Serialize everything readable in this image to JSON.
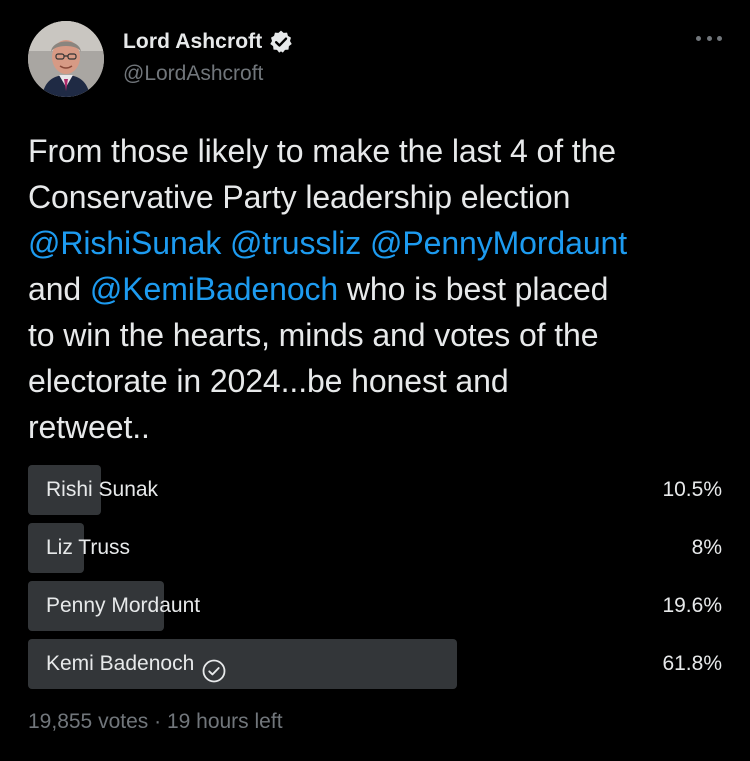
{
  "author": {
    "name": "Lord Ashcroft",
    "handle": "@LordAshcroft",
    "verified": true,
    "avatar_icon": "profile-photo"
  },
  "tweet": {
    "lines": [
      [
        {
          "text": "From those likely to make the last 4 of the",
          "mention": false
        }
      ],
      [
        {
          "text": "Conservative Party leadership election",
          "mention": false
        }
      ],
      [
        {
          "text": "@RishiSunak",
          "mention": true
        },
        {
          "text": " ",
          "mention": false
        },
        {
          "text": "@trussliz",
          "mention": true
        },
        {
          "text": " ",
          "mention": false
        },
        {
          "text": "@PennyMordaunt",
          "mention": true
        }
      ],
      [
        {
          "text": "and ",
          "mention": false
        },
        {
          "text": "@KemiBadenoch",
          "mention": true
        },
        {
          "text": " who is best placed",
          "mention": false
        }
      ],
      [
        {
          "text": "to win the hearts, minds and votes of the",
          "mention": false
        }
      ],
      [
        {
          "text": "electorate in 2024...be honest and",
          "mention": false
        }
      ],
      [
        {
          "text": "retweet..",
          "mention": false
        }
      ]
    ]
  },
  "poll": {
    "options": [
      {
        "label": "Rishi Sunak",
        "percent_text": "10.5%",
        "fraction": 0.105,
        "winner": false
      },
      {
        "label": "Liz Truss",
        "percent_text": "8%",
        "fraction": 0.08,
        "winner": false
      },
      {
        "label": "Penny Mordaunt",
        "percent_text": "19.6%",
        "fraction": 0.196,
        "winner": false
      },
      {
        "label": "Kemi Badenoch",
        "percent_text": "61.8%",
        "fraction": 0.618,
        "winner": true
      }
    ],
    "votes": "19,855 votes",
    "separator": "·",
    "time_left": "19 hours left"
  },
  "colors": {
    "background": "#000000",
    "text": "#e7e9ea",
    "muted": "#71767b",
    "mention": "#1d9bf0",
    "poll_bar": "#333639",
    "verified_badge": "#e7e9ea"
  }
}
